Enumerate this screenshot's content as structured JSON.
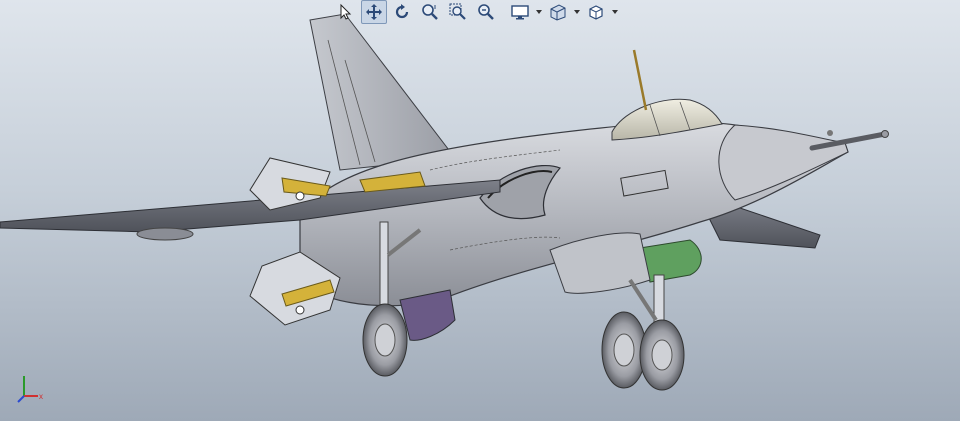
{
  "app": {
    "viewport_label": "",
    "background_top": "#dfe5ec",
    "background_bottom": "#9ea9b7"
  },
  "toolbar": {
    "buttons": [
      {
        "name": "select-icon",
        "label": ""
      },
      {
        "name": "pan-icon",
        "label": "",
        "active": true
      },
      {
        "name": "rotate-icon",
        "label": ""
      },
      {
        "name": "zoom-icon",
        "label": ""
      },
      {
        "name": "zoom-to-area-icon",
        "label": ""
      },
      {
        "name": "zoom-to-fit-icon",
        "label": ""
      },
      {
        "name": "display-style-icon",
        "label": "",
        "dropdown": true
      },
      {
        "name": "section-view-icon",
        "label": "",
        "dropdown": true
      },
      {
        "name": "view-orientation-icon",
        "label": "",
        "dropdown": true
      }
    ]
  },
  "triad": {
    "axis_x": "x",
    "axis_x_color": "#d03030",
    "axis_y_color": "#2a9a2a",
    "axis_z_color": "#2a4ad0"
  },
  "model": {
    "body_color": "#b9bcc3",
    "accent_yellow": "#d4b23a",
    "accent_green": "#5fa05f",
    "accent_purple": "#6a5a86"
  }
}
